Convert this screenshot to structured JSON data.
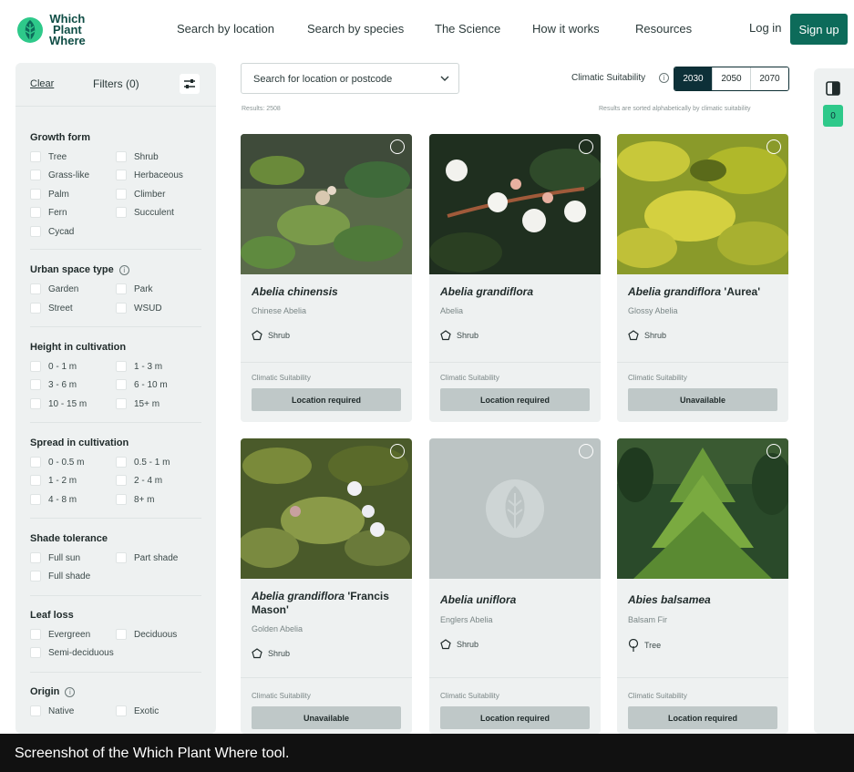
{
  "header": {
    "logo_lines": [
      "Which",
      "Plant",
      "Where"
    ],
    "nav": [
      "Search by location",
      "Search by species",
      "The Science",
      "How it works",
      "Resources"
    ],
    "login": "Log in",
    "signup": "Sign up"
  },
  "sidebar": {
    "clear": "Clear",
    "filters": "Filters (0)",
    "groups": {
      "growth_form": {
        "title": "Growth form",
        "options": [
          "Tree",
          "Shrub",
          "Grass-like",
          "Herbaceous",
          "Palm",
          "Climber",
          "Fern",
          "Succulent",
          "Cycad"
        ]
      },
      "urban_space": {
        "title": "Urban space type",
        "options": [
          "Garden",
          "Park",
          "Street",
          "WSUD"
        ]
      },
      "height": {
        "title": "Height in cultivation",
        "options": [
          "0 - 1 m",
          "1 - 3 m",
          "3 - 6 m",
          "6 - 10 m",
          "10 - 15 m",
          "15+ m"
        ]
      },
      "spread": {
        "title": "Spread in cultivation",
        "options": [
          "0 - 0.5 m",
          "0.5 - 1 m",
          "1 - 2 m",
          "2 - 4 m",
          "4 - 8 m",
          "8+ m"
        ]
      },
      "shade": {
        "title": "Shade tolerance",
        "options": [
          "Full sun",
          "Part shade",
          "Full shade"
        ]
      },
      "leaf_loss": {
        "title": "Leaf loss",
        "options": [
          "Evergreen",
          "Deciduous",
          "Semi-deciduous"
        ]
      },
      "origin": {
        "title": "Origin",
        "options": [
          "Native",
          "Exotic"
        ]
      }
    }
  },
  "search": {
    "placeholder": "Search for location or postcode"
  },
  "results_text": "Results: 2508",
  "sorted_text": "Results are sorted alphabetically by climatic suitability",
  "climatic": {
    "label": "Climatic Suitability",
    "years": [
      "2030",
      "2050",
      "2070"
    ],
    "active": "2030"
  },
  "cards": [
    {
      "genus_species": "Abelia chinensis",
      "cultivar": "",
      "common": "Chinese Abelia",
      "form": "Shrub",
      "cs_label": "Climatic Suitability",
      "status": "Location required"
    },
    {
      "genus_species": "Abelia grandiflora",
      "cultivar": "",
      "common": "Abelia",
      "form": "Shrub",
      "cs_label": "Climatic Suitability",
      "status": "Location required"
    },
    {
      "genus_species": "Abelia grandiflora",
      "cultivar": " 'Aurea'",
      "common": "Glossy Abelia",
      "form": "Shrub",
      "cs_label": "Climatic Suitability",
      "status": "Unavailable"
    },
    {
      "genus_species": "Abelia grandiflora",
      "cultivar": " 'Francis Mason'",
      "common": "Golden Abelia",
      "form": "Shrub",
      "cs_label": "Climatic Suitability",
      "status": "Unavailable"
    },
    {
      "genus_species": "Abelia uniflora",
      "cultivar": "",
      "common": "Englers Abelia",
      "form": "Shrub",
      "cs_label": "Climatic Suitability",
      "status": "Location required"
    },
    {
      "genus_species": "Abies balsamea",
      "cultivar": "",
      "common": "Balsam Fir",
      "form": "Tree",
      "cs_label": "Climatic Suitability",
      "status": "Location required"
    }
  ],
  "rail": {
    "count": "0"
  },
  "caption": "Screenshot of the Which Plant Where tool.",
  "colors": {
    "brand": "#0d6b5a",
    "dark": "#0d3038",
    "accent": "#2ec98a",
    "panel": "#eef1f1"
  }
}
